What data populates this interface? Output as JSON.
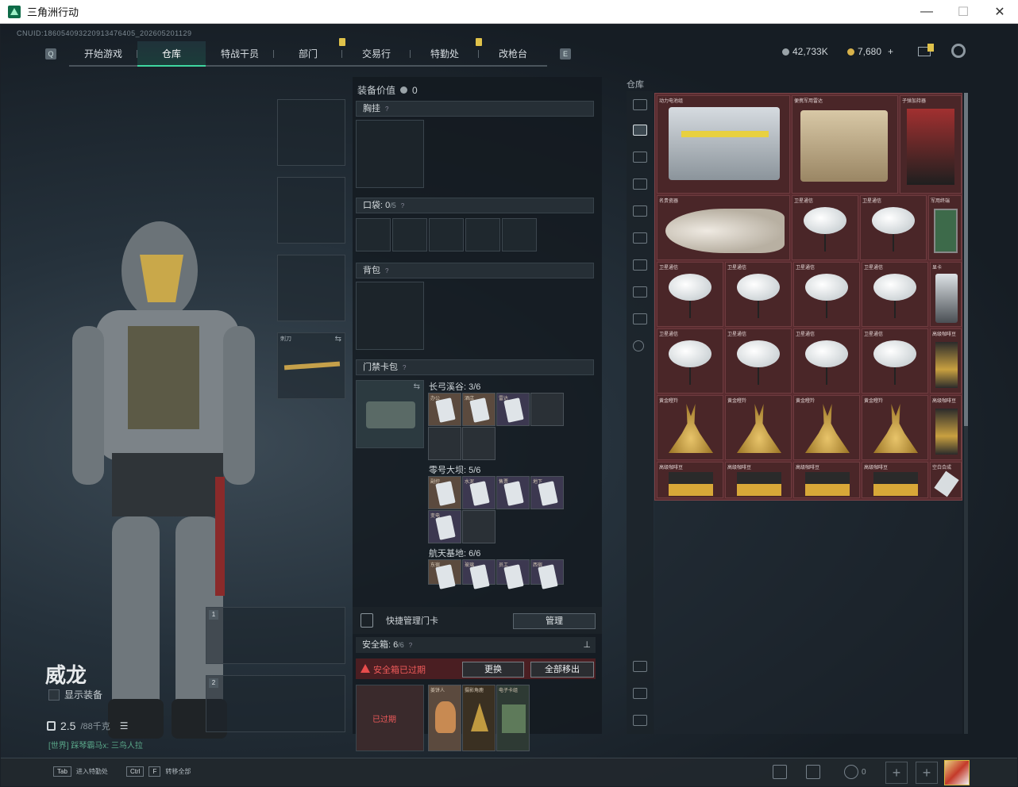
{
  "window": {
    "title": "三角洲行动",
    "controls": [
      "—",
      "☐",
      "✕"
    ]
  },
  "uid": "CNUID:186054093220913476405_202605201129",
  "nav": {
    "tabs": [
      {
        "label": "开始游戏",
        "badge": false,
        "active": false
      },
      {
        "label": "仓库",
        "badge": false,
        "active": true
      },
      {
        "label": "特战干员",
        "badge": false,
        "active": false
      },
      {
        "label": "部门",
        "badge": true,
        "active": false
      },
      {
        "label": "交易行",
        "badge": false,
        "active": false
      },
      {
        "label": "特勤处",
        "badge": true,
        "active": false
      },
      {
        "label": "改枪台",
        "badge": false,
        "active": false
      }
    ]
  },
  "currency": {
    "silver": "42,733K",
    "gold": "7,680",
    "gold_plus": "+"
  },
  "character": {
    "name": "威龙",
    "show_gear_label": "显示装备",
    "weight_value": "2.5",
    "weight_max": "/88千克",
    "chat_text": "[世界] 踩琴霸马x: 三鸟人拉"
  },
  "gear_slots": {
    "sidearm_label": "刺刀",
    "primary_1": "1",
    "primary_2": "2"
  },
  "equip": {
    "value_label": "装备价值",
    "value": "0",
    "chest_rig": "胸挂",
    "pockets_label": "口袋:",
    "pockets_count": "0",
    "pockets_max": "/5",
    "backpack": "背包",
    "keycard_bag": "门禁卡包",
    "groups": [
      {
        "title": "长弓溪谷: 3/6",
        "cards": [
          "办公",
          "酒店",
          "雷达"
        ]
      },
      {
        "title": "零号大坝: 5/6",
        "cards": [
          "副控",
          "水泥",
          "售票",
          "地下",
          "变电"
        ]
      },
      {
        "title": "航天基地: 6/6",
        "cards": [
          "东宿",
          "玻璃",
          "员工",
          "西宿"
        ]
      }
    ],
    "quick_manage": "快捷管理门卡",
    "manage_btn": "管理",
    "safe_label": "安全箱:",
    "safe_count": "6",
    "safe_max": "/6",
    "expired_text": "安全箱已过期",
    "replace_btn": "更换",
    "remove_all_btn": "全部移出",
    "expired_badge": "已过期",
    "safe_items": [
      "姜饼人",
      "摄影角鹿",
      "电子卡组"
    ]
  },
  "storage": {
    "label": "仓库",
    "items": [
      {
        "name": "动力电池组",
        "type": "battery"
      },
      {
        "name": "便携军用雷达",
        "type": "radar"
      },
      {
        "name": "子弹加持器",
        "type": "red"
      },
      {
        "name": "名贵瓷器",
        "type": "vase"
      },
      {
        "name": "卫星通信",
        "type": "dish"
      },
      {
        "name": "卫星通信",
        "type": "dish"
      },
      {
        "name": "军用终端",
        "type": "green"
      },
      {
        "name": "卫星通信",
        "type": "dish"
      },
      {
        "name": "卫星通信",
        "type": "dish"
      },
      {
        "name": "卫星通信",
        "type": "dish"
      },
      {
        "name": "卫星通信",
        "type": "dish"
      },
      {
        "name": "显卡",
        "type": "gpu"
      },
      {
        "name": "卫星通信",
        "type": "dish"
      },
      {
        "name": "卫星通信",
        "type": "dish"
      },
      {
        "name": "卫星通信",
        "type": "dish"
      },
      {
        "name": "卫星通信",
        "type": "dish"
      },
      {
        "name": "高级咖啡豆",
        "type": "coffee"
      },
      {
        "name": "黄金瞪羚",
        "type": "deer"
      },
      {
        "name": "黄金瞪羚",
        "type": "deer"
      },
      {
        "name": "黄金瞪羚",
        "type": "deer"
      },
      {
        "name": "黄金瞪羚",
        "type": "deer"
      },
      {
        "name": "高级咖啡豆",
        "type": "coffee"
      },
      {
        "name": "高级咖啡豆",
        "type": "box"
      },
      {
        "name": "高级咖啡豆",
        "type": "box"
      },
      {
        "name": "高级咖啡豆",
        "type": "box"
      },
      {
        "name": "高级咖啡豆",
        "type": "box"
      },
      {
        "name": "空白合成",
        "type": "usb"
      }
    ]
  },
  "bottom": {
    "tab_key": "Tab",
    "tab_text": "进入特勤处",
    "ctrl_key": "Ctrl",
    "f_key": "F",
    "ctrl_text": "转移全部",
    "friends_count": "0"
  },
  "colors": {
    "accent": "#3fd7a0",
    "warn": "#e84c4c",
    "badge": "#e0c24a",
    "storage_bg": "#5a2c30"
  }
}
